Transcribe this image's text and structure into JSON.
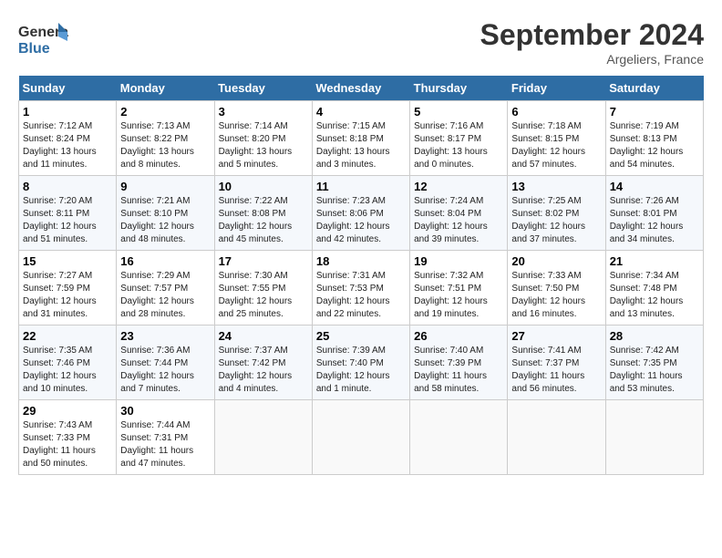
{
  "header": {
    "logo_text1": "General",
    "logo_text2": "Blue",
    "month": "September 2024",
    "location": "Argeliers, France"
  },
  "days_of_week": [
    "Sunday",
    "Monday",
    "Tuesday",
    "Wednesday",
    "Thursday",
    "Friday",
    "Saturday"
  ],
  "weeks": [
    [
      {
        "day": 1,
        "sunrise": "7:12 AM",
        "sunset": "8:24 PM",
        "daylight": "Daylight: 13 hours and 11 minutes."
      },
      {
        "day": 2,
        "sunrise": "7:13 AM",
        "sunset": "8:22 PM",
        "daylight": "Daylight: 13 hours and 8 minutes."
      },
      {
        "day": 3,
        "sunrise": "7:14 AM",
        "sunset": "8:20 PM",
        "daylight": "Daylight: 13 hours and 5 minutes."
      },
      {
        "day": 4,
        "sunrise": "7:15 AM",
        "sunset": "8:18 PM",
        "daylight": "Daylight: 13 hours and 3 minutes."
      },
      {
        "day": 5,
        "sunrise": "7:16 AM",
        "sunset": "8:17 PM",
        "daylight": "Daylight: 13 hours and 0 minutes."
      },
      {
        "day": 6,
        "sunrise": "7:18 AM",
        "sunset": "8:15 PM",
        "daylight": "Daylight: 12 hours and 57 minutes."
      },
      {
        "day": 7,
        "sunrise": "7:19 AM",
        "sunset": "8:13 PM",
        "daylight": "Daylight: 12 hours and 54 minutes."
      }
    ],
    [
      {
        "day": 8,
        "sunrise": "7:20 AM",
        "sunset": "8:11 PM",
        "daylight": "Daylight: 12 hours and 51 minutes."
      },
      {
        "day": 9,
        "sunrise": "7:21 AM",
        "sunset": "8:10 PM",
        "daylight": "Daylight: 12 hours and 48 minutes."
      },
      {
        "day": 10,
        "sunrise": "7:22 AM",
        "sunset": "8:08 PM",
        "daylight": "Daylight: 12 hours and 45 minutes."
      },
      {
        "day": 11,
        "sunrise": "7:23 AM",
        "sunset": "8:06 PM",
        "daylight": "Daylight: 12 hours and 42 minutes."
      },
      {
        "day": 12,
        "sunrise": "7:24 AM",
        "sunset": "8:04 PM",
        "daylight": "Daylight: 12 hours and 39 minutes."
      },
      {
        "day": 13,
        "sunrise": "7:25 AM",
        "sunset": "8:02 PM",
        "daylight": "Daylight: 12 hours and 37 minutes."
      },
      {
        "day": 14,
        "sunrise": "7:26 AM",
        "sunset": "8:01 PM",
        "daylight": "Daylight: 12 hours and 34 minutes."
      }
    ],
    [
      {
        "day": 15,
        "sunrise": "7:27 AM",
        "sunset": "7:59 PM",
        "daylight": "Daylight: 12 hours and 31 minutes."
      },
      {
        "day": 16,
        "sunrise": "7:29 AM",
        "sunset": "7:57 PM",
        "daylight": "Daylight: 12 hours and 28 minutes."
      },
      {
        "day": 17,
        "sunrise": "7:30 AM",
        "sunset": "7:55 PM",
        "daylight": "Daylight: 12 hours and 25 minutes."
      },
      {
        "day": 18,
        "sunrise": "7:31 AM",
        "sunset": "7:53 PM",
        "daylight": "Daylight: 12 hours and 22 minutes."
      },
      {
        "day": 19,
        "sunrise": "7:32 AM",
        "sunset": "7:51 PM",
        "daylight": "Daylight: 12 hours and 19 minutes."
      },
      {
        "day": 20,
        "sunrise": "7:33 AM",
        "sunset": "7:50 PM",
        "daylight": "Daylight: 12 hours and 16 minutes."
      },
      {
        "day": 21,
        "sunrise": "7:34 AM",
        "sunset": "7:48 PM",
        "daylight": "Daylight: 12 hours and 13 minutes."
      }
    ],
    [
      {
        "day": 22,
        "sunrise": "7:35 AM",
        "sunset": "7:46 PM",
        "daylight": "Daylight: 12 hours and 10 minutes."
      },
      {
        "day": 23,
        "sunrise": "7:36 AM",
        "sunset": "7:44 PM",
        "daylight": "Daylight: 12 hours and 7 minutes."
      },
      {
        "day": 24,
        "sunrise": "7:37 AM",
        "sunset": "7:42 PM",
        "daylight": "Daylight: 12 hours and 4 minutes."
      },
      {
        "day": 25,
        "sunrise": "7:39 AM",
        "sunset": "7:40 PM",
        "daylight": "Daylight: 12 hours and 1 minute."
      },
      {
        "day": 26,
        "sunrise": "7:40 AM",
        "sunset": "7:39 PM",
        "daylight": "Daylight: 11 hours and 58 minutes."
      },
      {
        "day": 27,
        "sunrise": "7:41 AM",
        "sunset": "7:37 PM",
        "daylight": "Daylight: 11 hours and 56 minutes."
      },
      {
        "day": 28,
        "sunrise": "7:42 AM",
        "sunset": "7:35 PM",
        "daylight": "Daylight: 11 hours and 53 minutes."
      }
    ],
    [
      {
        "day": 29,
        "sunrise": "7:43 AM",
        "sunset": "7:33 PM",
        "daylight": "Daylight: 11 hours and 50 minutes."
      },
      {
        "day": 30,
        "sunrise": "7:44 AM",
        "sunset": "7:31 PM",
        "daylight": "Daylight: 11 hours and 47 minutes."
      },
      null,
      null,
      null,
      null,
      null
    ]
  ]
}
